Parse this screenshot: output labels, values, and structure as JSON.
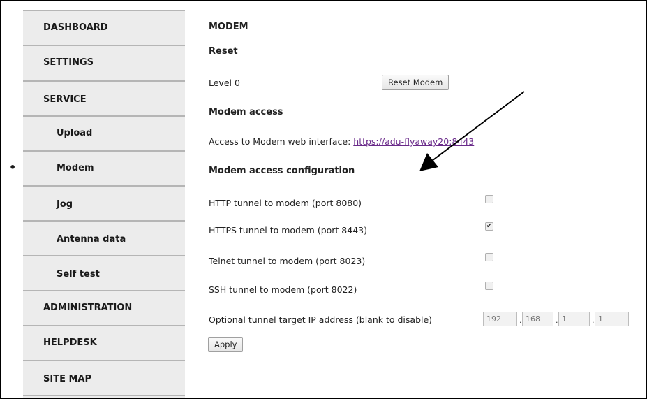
{
  "sidebar": {
    "items": [
      {
        "label": "DASHBOARD"
      },
      {
        "label": "SETTINGS"
      },
      {
        "label": "SERVICE"
      },
      {
        "label": "Upload"
      },
      {
        "label": "Modem"
      },
      {
        "label": "Jog"
      },
      {
        "label": "Antenna data"
      },
      {
        "label": "Self test"
      },
      {
        "label": "ADMINISTRATION"
      },
      {
        "label": "HELPDESK"
      },
      {
        "label": "SITE MAP"
      }
    ],
    "active_bullet": "•"
  },
  "main": {
    "page_title": "MODEM",
    "reset_heading": "Reset",
    "level_label": "Level 0",
    "reset_button": "Reset Modem",
    "access_heading": "Modem access",
    "access_text": "Access to Modem web interface: ",
    "access_link": "https://adu-flyaway20:8443",
    "config_heading": "Modem access configuration",
    "tunnels": [
      {
        "label": "HTTP tunnel to modem (port 8080)",
        "checked": false
      },
      {
        "label": "HTTPS tunnel to modem (port 8443)",
        "checked": true
      },
      {
        "label": "Telnet tunnel to modem (port 8023)",
        "checked": false
      },
      {
        "label": "SSH tunnel to modem (port 8022)",
        "checked": false
      }
    ],
    "ip_label": "Optional tunnel target IP address (blank to disable)",
    "ip_octets": [
      "192",
      "168",
      "1",
      "1"
    ],
    "ip_separator": ".",
    "apply_button": "Apply",
    "checkmark": "✔"
  }
}
